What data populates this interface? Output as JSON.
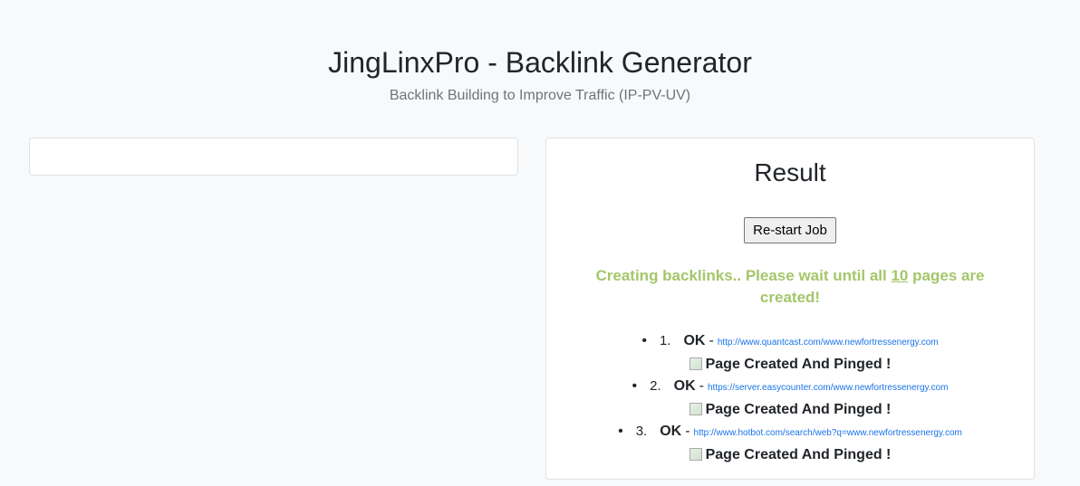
{
  "header": {
    "title": "JingLinxPro - Backlink Generator",
    "subtitle": "Backlink Building to Improve Traffic (IP-PV-UV)"
  },
  "result": {
    "title": "Result",
    "restart_label": "Re-start Job",
    "status_prefix": "Creating backlinks.. Please wait until all ",
    "status_count": "10",
    "status_suffix": " pages are created!",
    "status_color": "#a4c66a",
    "items": [
      {
        "number": "1.",
        "status": "OK",
        "separator": "-",
        "url": "http://www.quantcast.com/www.newfortressenergy.com",
        "message": "Page Created And Pinged !",
        "image_icon": "broken-image-icon"
      },
      {
        "number": "2.",
        "status": "OK",
        "separator": "-",
        "url": "https://server.easycounter.com/www.newfortressenergy.com",
        "message": "Page Created And Pinged !",
        "image_icon": "broken-image-icon"
      },
      {
        "number": "3.",
        "status": "OK",
        "separator": "-",
        "url": "http://www.hotbot.com/search/web?q=www.newfortressenergy.com",
        "message": "Page Created And Pinged !",
        "image_icon": "broken-image-icon"
      }
    ]
  },
  "colors": {
    "background": "#f8f9fa",
    "link": "#1a73e8",
    "card_border": "#dee2e6"
  }
}
